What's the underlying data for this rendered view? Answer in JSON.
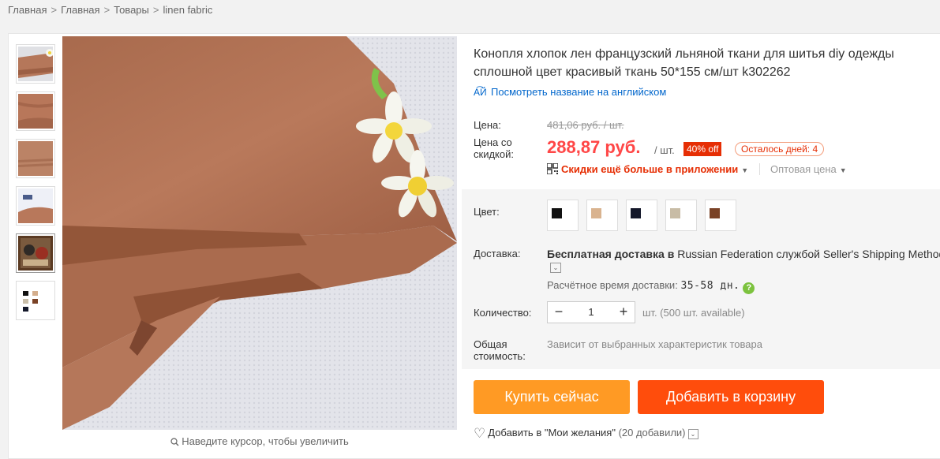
{
  "breadcrumb": [
    "Главная",
    "Главная",
    "Товары",
    "linen fabric"
  ],
  "breadcrumb_sep": ">",
  "product": {
    "title": "Конопля хлопок лен французский льняной ткани для шитья diy одежды сплошной цвет красивый ткань 50*155 см/шт k302262",
    "translate_link": "Посмотреть название на английском",
    "price_label": "Цена:",
    "old_price": "481,06 руб. / шт.",
    "discount_price_label": "Цена со скидкой:",
    "new_price": "288,87 руб.",
    "per_unit": "/ шт.",
    "discount_badge": "40% off",
    "days_left": "Осталось дней: 4",
    "app_promo": "Скидки ещё больше в приложении",
    "wholesale": "Оптовая цена",
    "color_label": "Цвет:",
    "colors": [
      {
        "name": "black",
        "hex": "#111111"
      },
      {
        "name": "tan",
        "hex": "#d9b38f"
      },
      {
        "name": "navy",
        "hex": "#14182a"
      },
      {
        "name": "beige",
        "hex": "#c8bca6"
      },
      {
        "name": "brown",
        "hex": "#7a4226"
      }
    ],
    "delivery_label": "Доставка:",
    "delivery_free": "Бесплатная доставка в",
    "delivery_rest": "Russian Federation службой Seller's Shipping Method",
    "est_label": "Расчётное время доставки:",
    "est_days": "35-58 дн.",
    "quantity_label": "Количество:",
    "quantity_value": "1",
    "quantity_avail": "шт. (500 шт. available)",
    "total_label": "Общая стоимость:",
    "total_text": "Зависит от выбранных характеристик товара",
    "buy_now": "Купить сейчас",
    "add_to_cart": "Добавить в корзину",
    "wishlist": "Добавить в \"Мои желания\"",
    "wishlist_count": "(20 добавили)"
  },
  "gallery": {
    "zoom_hint": "Наведите курсор, чтобы увеличить"
  },
  "colors": {
    "accent_red": "#ff4747",
    "buy_orange": "#ff9a24",
    "cart_orange": "#ff4d0c",
    "link_blue": "#0066cc"
  }
}
